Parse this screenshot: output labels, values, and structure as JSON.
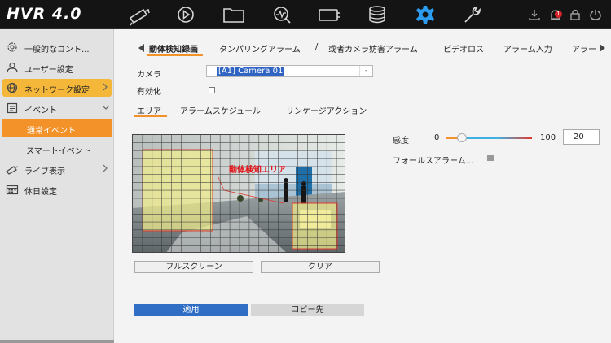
{
  "brand": "HVR 4.0",
  "top_nav": {
    "icons": [
      "camera-icon",
      "playback-icon",
      "folder-icon",
      "analytics-icon",
      "ptz-icon",
      "storage-icon",
      "settings-icon",
      "maintenance-icon"
    ],
    "selected": "settings-icon",
    "alarm_count": "1"
  },
  "sidebar": {
    "items": [
      {
        "label": "一般的なコント...",
        "icon": "gear-icon"
      },
      {
        "label": "ユーザー設定",
        "icon": "user-icon"
      },
      {
        "label": "ネットワーク設定",
        "icon": "globe-icon"
      },
      {
        "label": "イベント",
        "icon": "event-icon"
      },
      {
        "label": "通常イベント"
      },
      {
        "label": "スマートイベント"
      },
      {
        "label": "ライブ表示",
        "icon": "live-view-icon"
      },
      {
        "label": "休日設定",
        "icon": "calendar-icon"
      }
    ]
  },
  "tabs": [
    "動体検知録画",
    "タンパリングアラーム",
    "/",
    "或者カメラ妨害アラーム",
    "ビデオロス",
    "アラーム入力",
    "アラー"
  ],
  "form": {
    "camera_label": "カメラ",
    "camera_value": "[A1] Camera 01",
    "enable_label": "有効化"
  },
  "subtabs": [
    "エリア",
    "アラームスケジュール",
    "リンケージアクション"
  ],
  "video": {
    "overlay_label": "動体検知エリア"
  },
  "buttons": {
    "fullscreen": "フルスクリーン",
    "clear": "クリア",
    "apply": "適用",
    "copy": "コピー先"
  },
  "sensitivity": {
    "label": "感度",
    "min": "0",
    "max": "100",
    "value": "20",
    "level": 0.2
  },
  "false_alarm_label": "フォールスアラーム..."
}
